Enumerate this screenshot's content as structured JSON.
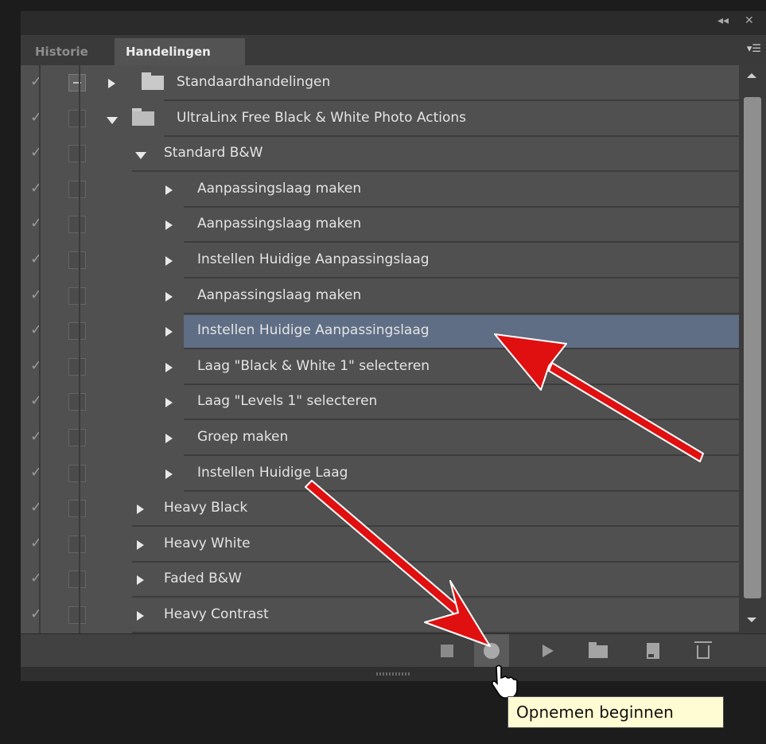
{
  "window": {
    "collapse_icon": "double-chevron-left-icon",
    "close_icon": "close-icon",
    "collapse_glyph": "◂◂",
    "close_glyph": "✕"
  },
  "tabs": [
    {
      "label": "Historie",
      "active": false
    },
    {
      "label": "Handelingen",
      "active": true
    }
  ],
  "tab_menu_icon": "panel-menu-icon",
  "tab_menu_glyph": "▾☰",
  "actions": [
    {
      "label": "Standaardhandelingen",
      "level": 0,
      "type": "set",
      "expanded": false,
      "dialog_box": true
    },
    {
      "label": "UltraLinx Free Black & White Photo Actions",
      "level": 0,
      "type": "set",
      "expanded": true,
      "dialog_box": false
    },
    {
      "label": "Standard B&W",
      "level": 1,
      "type": "action",
      "expanded": true
    },
    {
      "label": "Aanpassingslaag maken",
      "level": 2,
      "type": "step"
    },
    {
      "label": "Aanpassingslaag maken",
      "level": 2,
      "type": "step"
    },
    {
      "label": "Instellen  Huidige Aanpassingslaag",
      "level": 2,
      "type": "step"
    },
    {
      "label": "Aanpassingslaag maken",
      "level": 2,
      "type": "step"
    },
    {
      "label": "Instellen  Huidige Aanpassingslaag",
      "level": 2,
      "type": "step",
      "selected": true
    },
    {
      "label": "Laag \"Black & White 1\" selecteren",
      "level": 2,
      "type": "step"
    },
    {
      "label": "Laag \"Levels 1\" selecteren",
      "level": 2,
      "type": "step"
    },
    {
      "label": "Groep maken",
      "level": 2,
      "type": "step"
    },
    {
      "label": "Instellen  Huidige Laag",
      "level": 2,
      "type": "step"
    },
    {
      "label": "Heavy Black",
      "level": 1,
      "type": "action",
      "expanded": false
    },
    {
      "label": "Heavy White",
      "level": 1,
      "type": "action",
      "expanded": false
    },
    {
      "label": "Faded B&W",
      "level": 1,
      "type": "action",
      "expanded": false
    },
    {
      "label": "Heavy Contrast",
      "level": 1,
      "type": "action",
      "expanded": false
    }
  ],
  "check_glyph": "✓",
  "toolbar": {
    "buttons": [
      {
        "name": "stop-button",
        "icon": "stop-icon"
      },
      {
        "name": "record-button",
        "icon": "record-icon"
      },
      {
        "name": "play-button",
        "icon": "play-icon"
      },
      {
        "name": "new-set-button",
        "icon": "folder-icon"
      },
      {
        "name": "new-action-button",
        "icon": "new-item-icon"
      },
      {
        "name": "delete-button",
        "icon": "trash-icon"
      }
    ]
  },
  "tooltip": "Opnemen beginnen",
  "colors": {
    "selection": "#5f6e85",
    "annotation_arrow": "#e01010",
    "tooltip_bg": "#fffbd3"
  }
}
